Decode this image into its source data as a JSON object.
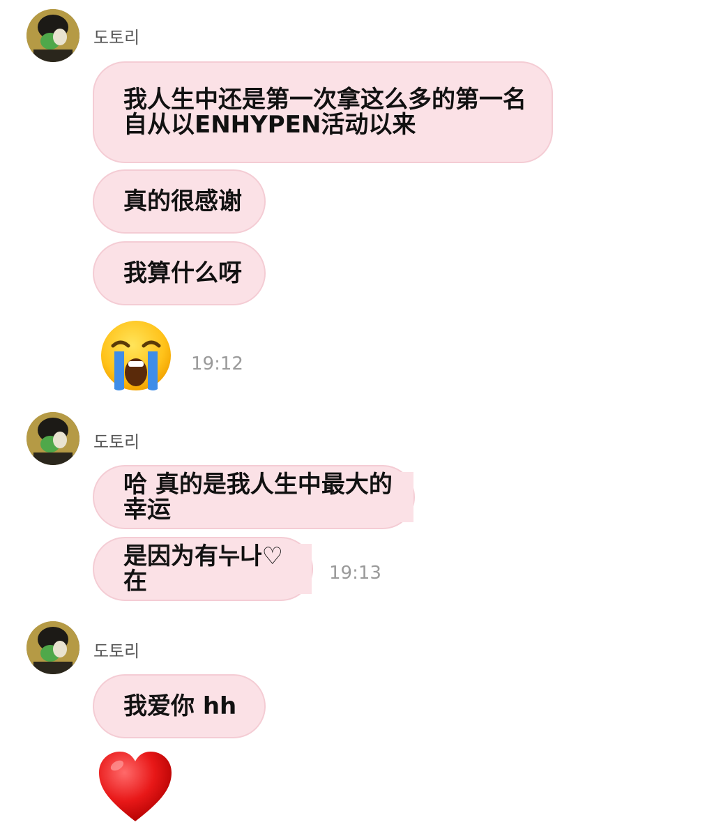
{
  "groups": [
    {
      "sender": "도토리",
      "messages": [
        "我人生中还是第一次拿这么多的第一名\n自从以ENHYPEN活动以来",
        "真的很感谢",
        "我算什么呀"
      ],
      "emoji": "loudly-crying-face",
      "time": "19:12"
    },
    {
      "sender": "도토리",
      "messages": [
        "哈 真的是我人生中最大的幸运",
        "是因为有누나♡在"
      ],
      "time": "19:13"
    },
    {
      "sender": "도토리",
      "messages": [
        "我爱你 hh"
      ],
      "emoji": "red-heart"
    }
  ],
  "colors": {
    "bubble": "#fbe1e6",
    "bubble_border": "#f4ccd4",
    "timestamp": "#9a9a9a"
  }
}
